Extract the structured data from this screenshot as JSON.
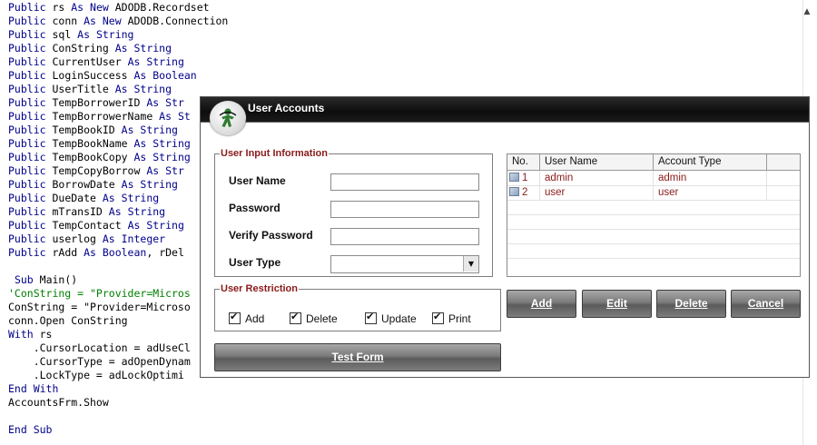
{
  "code": {
    "lines": [
      [
        [
          "kw",
          "Public"
        ],
        [
          "t",
          " rs "
        ],
        [
          "kw",
          "As New"
        ],
        [
          "t",
          " ADODB.Recordset"
        ]
      ],
      [
        [
          "kw",
          "Public"
        ],
        [
          "t",
          " conn "
        ],
        [
          "kw",
          "As New"
        ],
        [
          "t",
          " ADODB.Connection"
        ]
      ],
      [
        [
          "kw",
          "Public"
        ],
        [
          "t",
          " sql "
        ],
        [
          "kw",
          "As String"
        ]
      ],
      [
        [
          "kw",
          "Public"
        ],
        [
          "t",
          " ConString "
        ],
        [
          "kw",
          "As String"
        ]
      ],
      [
        [
          "kw",
          "Public"
        ],
        [
          "t",
          " CurrentUser "
        ],
        [
          "kw",
          "As String"
        ]
      ],
      [
        [
          "kw",
          "Public"
        ],
        [
          "t",
          " LoginSuccess "
        ],
        [
          "kw",
          "As Boolean"
        ]
      ],
      [
        [
          "kw",
          "Public"
        ],
        [
          "t",
          " UserTitle "
        ],
        [
          "kw",
          "As String"
        ]
      ],
      [
        [
          "kw",
          "Public"
        ],
        [
          "t",
          " TempBorrowerID "
        ],
        [
          "kw",
          "As Str"
        ]
      ],
      [
        [
          "kw",
          "Public"
        ],
        [
          "t",
          " TempBorrowerName "
        ],
        [
          "kw",
          "As St"
        ]
      ],
      [
        [
          "kw",
          "Public"
        ],
        [
          "t",
          " TempBookID "
        ],
        [
          "kw",
          "As String"
        ]
      ],
      [
        [
          "kw",
          "Public"
        ],
        [
          "t",
          " TempBookName "
        ],
        [
          "kw",
          "As String"
        ]
      ],
      [
        [
          "kw",
          "Public"
        ],
        [
          "t",
          " TempBookCopy "
        ],
        [
          "kw",
          "As String"
        ]
      ],
      [
        [
          "kw",
          "Public"
        ],
        [
          "t",
          " TempCopyBorrow "
        ],
        [
          "kw",
          "As Str"
        ]
      ],
      [
        [
          "kw",
          "Public"
        ],
        [
          "t",
          " BorrowDate "
        ],
        [
          "kw",
          "As String"
        ]
      ],
      [
        [
          "kw",
          "Public"
        ],
        [
          "t",
          " DueDate "
        ],
        [
          "kw",
          "As String"
        ]
      ],
      [
        [
          "kw",
          "Public"
        ],
        [
          "t",
          " mTransID "
        ],
        [
          "kw",
          "As String"
        ]
      ],
      [
        [
          "kw",
          "Public"
        ],
        [
          "t",
          " TempContact "
        ],
        [
          "kw",
          "As String"
        ]
      ],
      [
        [
          "kw",
          "Public"
        ],
        [
          "t",
          " userlog "
        ],
        [
          "kw",
          "As Integer"
        ]
      ],
      [
        [
          "kw",
          "Public"
        ],
        [
          "t",
          " rAdd "
        ],
        [
          "kw",
          "As Boolean"
        ],
        [
          "t",
          ", rDel"
        ]
      ],
      [],
      [
        [
          "t",
          " "
        ],
        [
          "kw",
          "Sub"
        ],
        [
          "t",
          " Main()"
        ]
      ],
      [
        [
          "cm",
          "'ConString = \"Provider=Micros"
        ]
      ],
      [
        [
          "t",
          "ConString = \"Provider=Microso"
        ]
      ],
      [
        [
          "t",
          "conn.Open ConString"
        ]
      ],
      [
        [
          "kw",
          "With"
        ],
        [
          "t",
          " rs"
        ]
      ],
      [
        [
          "t",
          "    .CursorLocation = adUseCl"
        ]
      ],
      [
        [
          "t",
          "    .CursorType = adOpenDynam"
        ]
      ],
      [
        [
          "t",
          "    .LockType = adLockOptimi"
        ]
      ],
      [
        [
          "kw",
          "End With"
        ]
      ],
      [
        [
          "t",
          "AccountsFrm.Show"
        ]
      ],
      [],
      [
        [
          "kw",
          "End Sub"
        ]
      ]
    ]
  },
  "window": {
    "title": "User Accounts"
  },
  "input_group": {
    "legend": "User Input Information",
    "username_label": "User Name",
    "username_value": "",
    "password_label": "Password",
    "password_value": "",
    "verify_label": "Verify Password",
    "verify_value": "",
    "usertype_label": "User Type",
    "usertype_value": ""
  },
  "restriction_group": {
    "legend": "User Restriction",
    "items": [
      {
        "label": "Add",
        "checked": true
      },
      {
        "label": "Delete",
        "checked": true
      },
      {
        "label": "Update",
        "checked": true
      },
      {
        "label": "Print",
        "checked": true
      }
    ]
  },
  "grid": {
    "columns": [
      "No.",
      "User Name",
      "Account Type"
    ],
    "rows": [
      {
        "no": "1",
        "username": "admin",
        "type": "admin"
      },
      {
        "no": "2",
        "username": "user",
        "type": "user"
      }
    ]
  },
  "buttons": {
    "add": "Add",
    "edit": "Edit",
    "delete": "Delete",
    "cancel": "Cancel",
    "test_form": "Test Form"
  }
}
